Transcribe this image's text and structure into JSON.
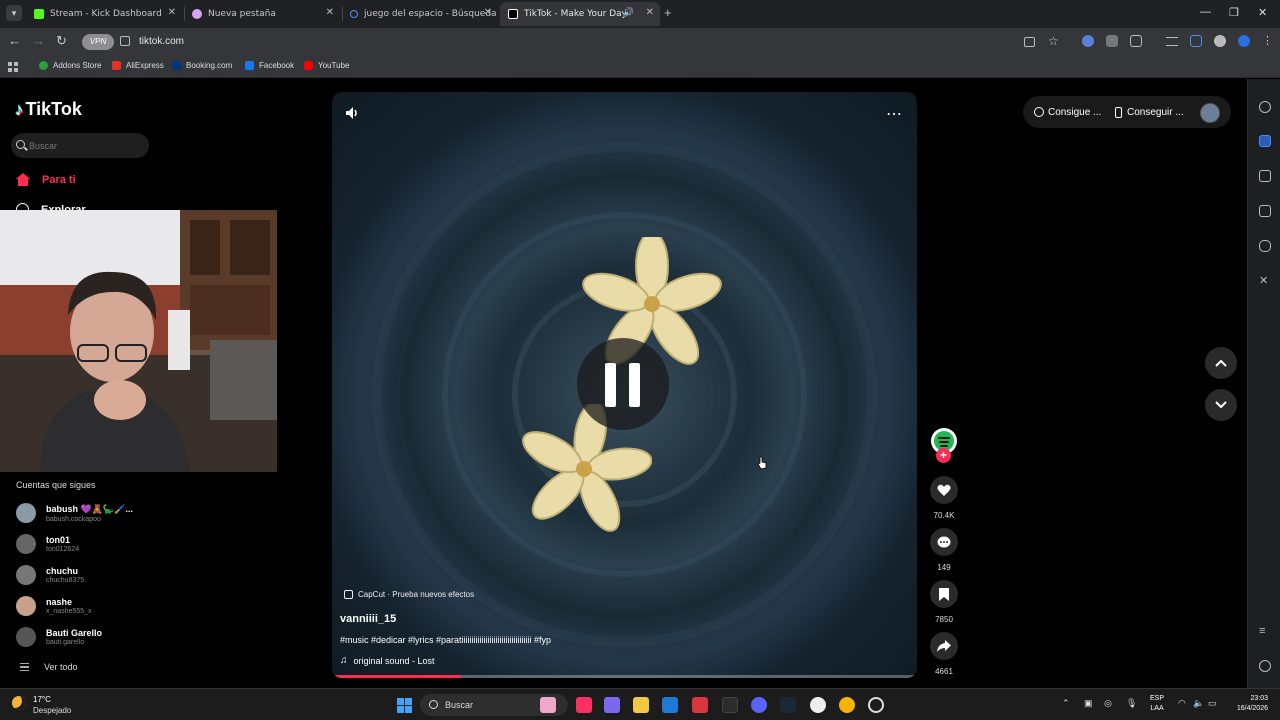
{
  "browser": {
    "tabs": [
      {
        "title": "Stream - Kick Dashboard",
        "color": "#53fc18"
      },
      {
        "title": "Nueva pestaña",
        "color": "#d8a3f5"
      },
      {
        "title": "juego del espacio - Búsqueda",
        "color": "#4c8cf5"
      },
      {
        "title": "TikTok - Make Your Day",
        "color": "#ffffff"
      }
    ],
    "url": "tiktok.com",
    "vpn_label": "VPN",
    "bookmarks": [
      {
        "label": "Addons Store",
        "color": "#2e9e3f"
      },
      {
        "label": "AliExpress",
        "color": "#e43225"
      },
      {
        "label": "Booking.com",
        "color": "#003580"
      },
      {
        "label": "Facebook",
        "color": "#1877f2"
      },
      {
        "label": "YouTube",
        "color": "#ff0000"
      }
    ]
  },
  "tiktok": {
    "brand": "TikTok",
    "search_placeholder": "Buscar",
    "nav_for_you": "Para ti",
    "nav_explore": "Explorar",
    "following_title": "Cuentas que sigues",
    "following": [
      {
        "name": "babush 💜🧸🦕🖌️...",
        "handle": "babush.cockapoo",
        "color": "#8a9aa8"
      },
      {
        "name": "ton01",
        "handle": "ton012624",
        "color": "#666"
      },
      {
        "name": "chuchu",
        "handle": "chuchu8375",
        "color": "#777"
      },
      {
        "name": "nashe",
        "handle": "x_nashe555_x",
        "color": "#c9a08a"
      },
      {
        "name": "Bauti Garello",
        "handle": "bauti.garello",
        "color": "#555"
      }
    ],
    "see_all": "Ver todo",
    "top_buttons": {
      "coins": "Consigue ...",
      "app": "Conseguir ..."
    },
    "video": {
      "effect_label": "CapCut · Prueba nuevos efectos",
      "author": "vanniiii_15",
      "caption": "#music #dedicar #lyrics #paratiiiiiiiiiiiiiiiiiiiiiiiiiiiiiiiiiii #fyp",
      "sound": "original sound - Lost",
      "progress": 0.22
    },
    "actions": {
      "likes": "70.4K",
      "comments": "149",
      "saves": "7850",
      "shares": "4661"
    },
    "accent": "#fe2c55"
  },
  "taskbar": {
    "temp": "17°C",
    "weather": "Despejado",
    "search": "Buscar",
    "lang_top": "ESP",
    "lang_bottom": "LAA",
    "time": "23:03",
    "date": "16/4/2026"
  }
}
